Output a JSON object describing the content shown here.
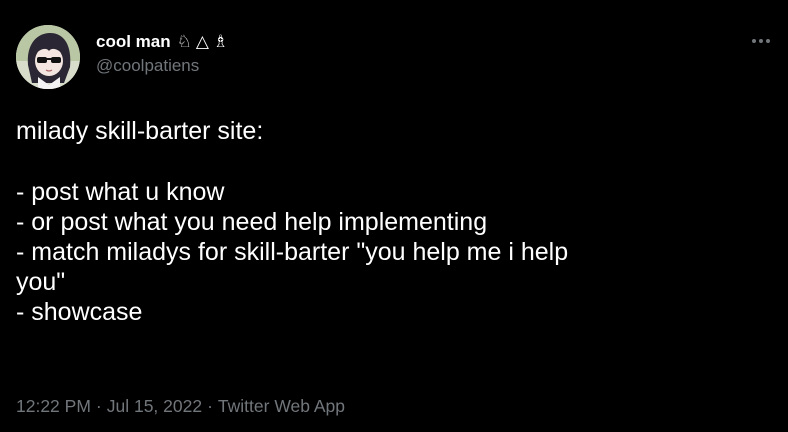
{
  "author": {
    "display_name": "cool man",
    "name_symbols": [
      "♘",
      "△",
      "♗"
    ],
    "handle": "@coolpatiens"
  },
  "tweet": {
    "lines": [
      "milady skill-barter site:",
      "",
      "- post what u know",
      "- or post what you need help implementing",
      "- match miladys for skill-barter \"you help me i help",
      "you\"",
      "- showcase"
    ]
  },
  "meta": {
    "time": "12:22 PM",
    "date": "Jul 15, 2022",
    "separator": "·",
    "source": "Twitter Web App"
  },
  "icons": {
    "more": "more-dots-icon",
    "avatar": "profile-avatar"
  },
  "colors": {
    "background": "#000000",
    "text": "#ffffff",
    "secondary": "#71767b"
  }
}
